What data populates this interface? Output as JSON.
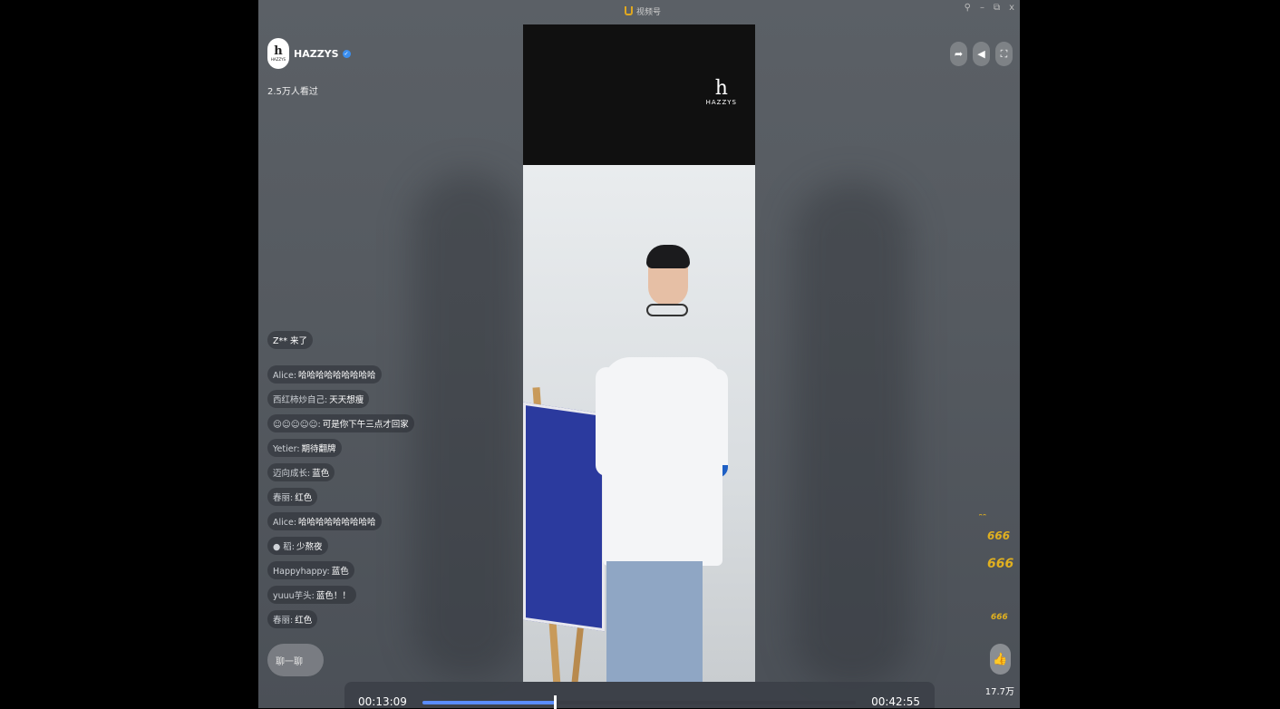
{
  "window": {
    "title": "视频号",
    "controls": [
      "⚲",
      "–",
      "⧉",
      "x"
    ]
  },
  "streamer": {
    "name": "HAZZYS",
    "viewers": "2.5万人看过",
    "avatar_letter": "h",
    "avatar_text": "HAZZYS"
  },
  "video": {
    "logo_letter": "h",
    "logo_text": "HAZZYS"
  },
  "chat": {
    "join_notice": "Z** 来了",
    "messages": [
      {
        "user": "Alice:",
        "text": "哈哈哈哈哈哈哈哈哈"
      },
      {
        "user": "西红柿炒自己:",
        "text": "天天想瘦"
      },
      {
        "user": "☺☺☺☺☺:",
        "text": "可是你下午三点才回家"
      },
      {
        "user": "Yetier:",
        "text": "期待翻牌"
      },
      {
        "user": "迈向成长:",
        "text": "蓝色"
      },
      {
        "user": "春丽:",
        "text": "红色"
      },
      {
        "user": "Alice:",
        "text": "哈哈哈哈哈哈哈哈哈"
      },
      {
        "user": "● 稻:",
        "text": "少熬夜"
      },
      {
        "user": "Happyhappy:",
        "text": "蓝色"
      },
      {
        "user": "yuuu芋头:",
        "text": "蓝色！！"
      },
      {
        "user": "春丽:",
        "text": "红色"
      }
    ],
    "input_placeholder": "聊一聊"
  },
  "likes": {
    "count": "17.7万"
  },
  "player": {
    "current_time": "00:13:09",
    "total_time": "00:42:55",
    "progress": 0.306
  },
  "icons": {
    "share": "share-icon",
    "volume": "volume-icon",
    "fullscreen": "fullscreen-icon",
    "like": "thumbs-up-icon",
    "verified": "verified-icon"
  },
  "colors": {
    "progress_fill": "#5a8cff",
    "verified": "#3b8ff0",
    "emoji_accent": "#e0b020"
  }
}
